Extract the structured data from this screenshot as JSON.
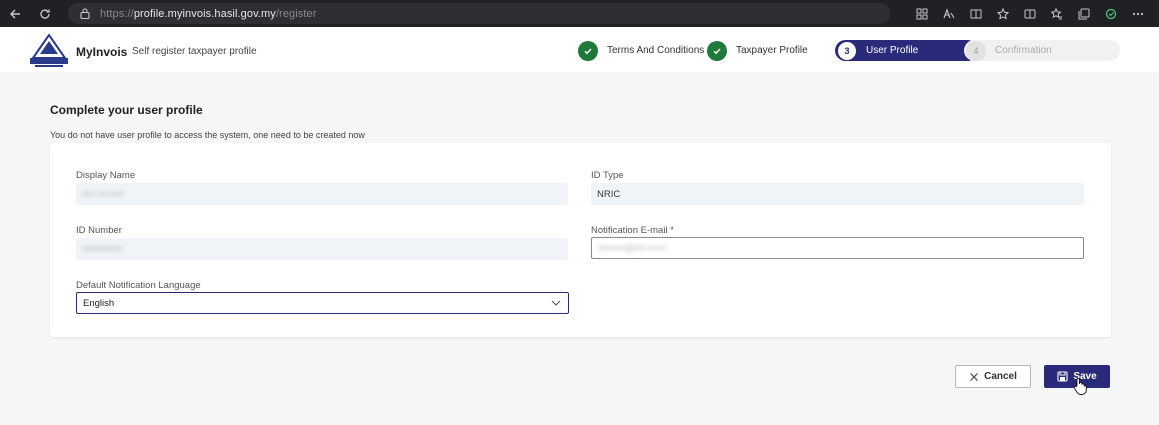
{
  "browser": {
    "url_scheme": "https://",
    "url_host": "profile.myinvois.hasil.gov.my",
    "url_path": "/register"
  },
  "header": {
    "brand": "MyInvois",
    "subtitle": "Self register taxpayer profile"
  },
  "stepper": {
    "steps": [
      {
        "number": "1",
        "label": "Terms And Conditions",
        "state": "done"
      },
      {
        "number": "2",
        "label": "Taxpayer Profile",
        "state": "done"
      },
      {
        "number": "3",
        "label": "User Profile",
        "state": "active"
      },
      {
        "number": "4",
        "label": "Confirmation",
        "state": "pending"
      }
    ]
  },
  "form": {
    "title": "Complete your user profile",
    "description": "You do not have user profile to access the system, one need to be created now",
    "display_name_label": "Display Name",
    "display_name_value": "•••• ••• ••••",
    "id_type_label": "ID Type",
    "id_type_value": "NRIC",
    "id_number_label": "ID Number",
    "id_number_value": "••••••••••••",
    "email_label": "Notification E-mail *",
    "email_value": "••••••••@•••.•••.••",
    "language_label": "Default Notification Language",
    "language_value": "English"
  },
  "actions": {
    "cancel_label": "Cancel",
    "save_label": "Save"
  },
  "colors": {
    "primary": "#2a2a7a",
    "success": "#1f7a3a"
  }
}
